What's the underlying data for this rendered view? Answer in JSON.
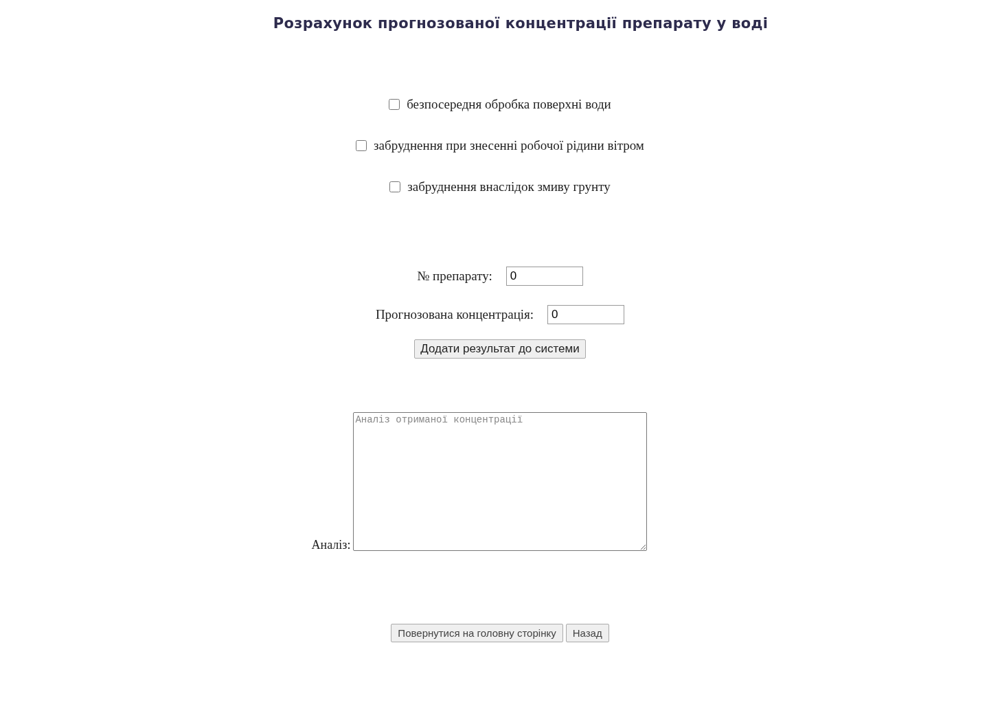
{
  "title": "Розрахунок прогнозованої концентрації препарату у воді",
  "options": [
    {
      "label": "безпосередня обробка поверхні води",
      "checked": false
    },
    {
      "label": "забруднення при знесенні робочої рідини вітром",
      "checked": false
    },
    {
      "label": "забруднення внаслідок змиву грунту",
      "checked": false
    }
  ],
  "fields": [
    {
      "label": "№ препарату:",
      "value": "0"
    },
    {
      "label": "Прогнозована концентрація:",
      "value": "0"
    }
  ],
  "add_button": "Додати результат до системи",
  "analysis": {
    "label": "Аналіз:",
    "placeholder": "Аналіз отриманої концентрації"
  },
  "buttons": [
    "Повернутися на головну сторінку",
    "Назад"
  ]
}
